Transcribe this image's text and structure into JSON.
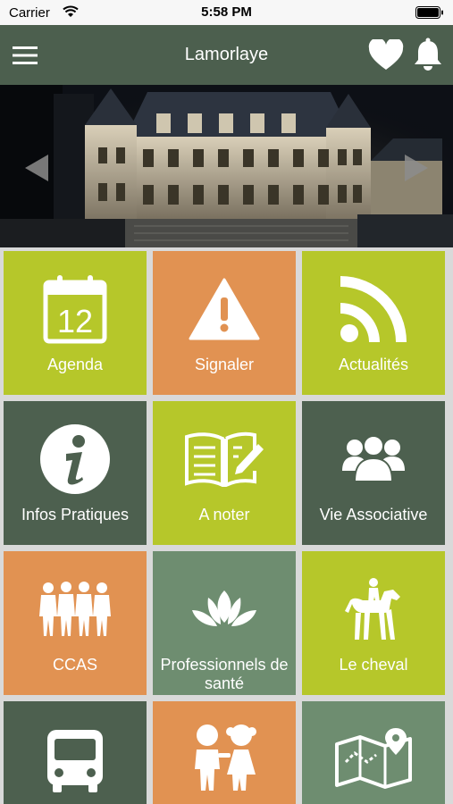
{
  "status": {
    "carrier": "Carrier",
    "time": "5:58 PM"
  },
  "header": {
    "title": "Lamorlaye"
  },
  "colors": {
    "header": "#4c5f4e",
    "lime": "#b6c72a",
    "orange": "#e19252",
    "dark": "#4d604f",
    "sage": "#6e8d70"
  },
  "tiles": [
    {
      "label": "Agenda",
      "icon": "calendar-icon",
      "day": "12"
    },
    {
      "label": "Signaler",
      "icon": "warning-icon"
    },
    {
      "label": "Actualités",
      "icon": "rss-icon"
    },
    {
      "label": "Infos Pratiques",
      "icon": "info-icon"
    },
    {
      "label": "A noter",
      "icon": "notebook-icon"
    },
    {
      "label": "Vie Associative",
      "icon": "group-icon"
    },
    {
      "label": "CCAS",
      "icon": "people-icon"
    },
    {
      "label": "Professionnels de santé",
      "icon": "lotus-icon"
    },
    {
      "label": "Le cheval",
      "icon": "horse-rider-icon"
    },
    {
      "label": "",
      "icon": "bus-icon"
    },
    {
      "label": "",
      "icon": "children-icon"
    },
    {
      "label": "",
      "icon": "map-icon"
    }
  ]
}
